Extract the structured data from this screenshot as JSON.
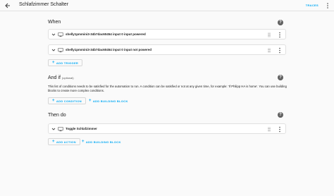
{
  "header": {
    "title": "Schlafzimmer Schalter",
    "traces_label": "TRACES"
  },
  "when": {
    "title": "When",
    "triggers": [
      {
        "label": "shelly1pmmini3-34b7dac60454 input 0 input powered"
      },
      {
        "label": "shelly1pmmini3-34b7dac60454 input 0 input not powered"
      }
    ],
    "add_trigger_label": "ADD TRIGGER"
  },
  "and_if": {
    "title": "And if",
    "optional_label": "(optional)",
    "description": "This list of conditions needs to be satisfied for the automation to run. A condition can be satisfied or not at any given time, for example: 'If Philipp HA is home'. You can use building blocks to create more complex conditions.",
    "add_condition_label": "ADD CONDITION",
    "add_building_block_label": "ADD BUILDING BLOCK"
  },
  "then_do": {
    "title": "Then do",
    "actions": [
      {
        "label": "Toggle Schlafzimmer"
      }
    ],
    "add_action_label": "ADD ACTION",
    "add_building_block_label": "ADD BUILDING BLOCK"
  },
  "colors": {
    "accent": "#03a9f4",
    "icon": "#616161",
    "background": "#fafafa"
  }
}
